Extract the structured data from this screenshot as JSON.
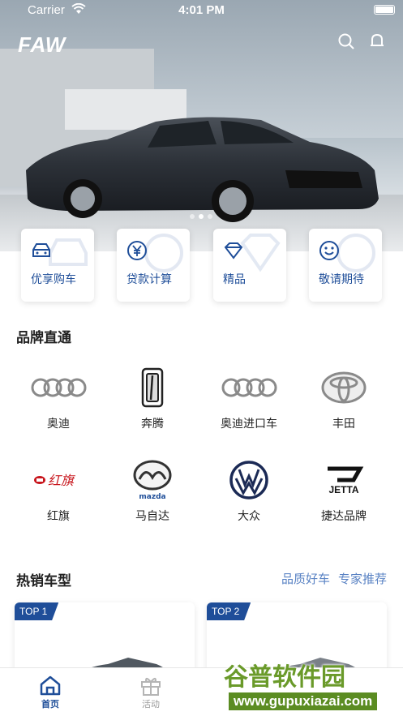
{
  "status_bar": {
    "carrier": "Carrier",
    "time": "4:01 PM"
  },
  "header": {
    "logo_text": "FAW",
    "search_icon": "search-icon",
    "bell_icon": "bell-icon"
  },
  "banner": {
    "slide_count": 3,
    "active_slide": 2
  },
  "quick_entries": [
    {
      "label": "优享购车",
      "icon": "car-icon"
    },
    {
      "label": "贷款计算",
      "icon": "yen-coin-icon"
    },
    {
      "label": "精品",
      "icon": "diamond-icon"
    },
    {
      "label": "敬请期待",
      "icon": "smile-icon"
    }
  ],
  "brands": {
    "title": "品牌直通",
    "items": [
      {
        "name": "奥迪",
        "icon": "audi-logo"
      },
      {
        "name": "奔腾",
        "icon": "bestune-logo"
      },
      {
        "name": "奥迪进口车",
        "icon": "audi-logo"
      },
      {
        "name": "丰田",
        "icon": "toyota-logo"
      },
      {
        "name": "红旗",
        "icon": "hongqi-logo",
        "logo_text": "红旗"
      },
      {
        "name": "马自达",
        "icon": "mazda-logo",
        "logo_text": "mazda"
      },
      {
        "name": "大众",
        "icon": "vw-logo"
      },
      {
        "name": "捷达品牌",
        "icon": "jetta-logo",
        "logo_text": "JETTA"
      }
    ]
  },
  "hot_models": {
    "title": "热销车型",
    "subtitle_1": "品质好车",
    "subtitle_2": "专家推荐",
    "cards": [
      {
        "tag": "TOP 1"
      },
      {
        "tag": "TOP 2"
      }
    ]
  },
  "tab_bar": {
    "items": [
      {
        "label": "首页",
        "icon": "home-icon",
        "active": true
      },
      {
        "label": "活动",
        "icon": "gift-icon",
        "active": false
      }
    ]
  },
  "watermark": {
    "line1": "谷普软件园",
    "line2": "www.gupuxiazai.com"
  },
  "colors": {
    "accent": "#1f4e99",
    "link": "#5a83c4",
    "watermark": "#5b8c22"
  }
}
